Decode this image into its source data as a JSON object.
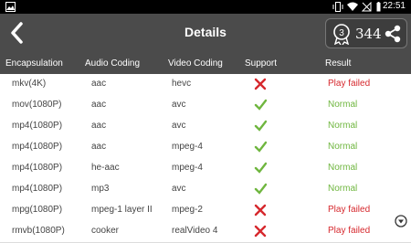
{
  "status": {
    "time": "22:51"
  },
  "header": {
    "title": "Details",
    "score": "344"
  },
  "table": {
    "columns": [
      "Encapsulation",
      "Audio Coding",
      "Video Coding",
      "Support",
      "Result"
    ],
    "rows": [
      {
        "encap": "mkv(4K)",
        "audio": "aac",
        "video": "hevc",
        "support": "cross",
        "result": "Play failed"
      },
      {
        "encap": "mov(1080P)",
        "audio": "aac",
        "video": "avc",
        "support": "check",
        "result": "Normal"
      },
      {
        "encap": "mp4(1080P)",
        "audio": "aac",
        "video": "avc",
        "support": "check",
        "result": "Normal"
      },
      {
        "encap": "mp4(1080P)",
        "audio": "aac",
        "video": "mpeg-4",
        "support": "check",
        "result": "Normal"
      },
      {
        "encap": "mp4(1080P)",
        "audio": "he-aac",
        "video": "mpeg-4",
        "support": "check",
        "result": "Normal"
      },
      {
        "encap": "mp4(1080P)",
        "audio": "mp3",
        "video": "avc",
        "support": "check",
        "result": "Normal"
      },
      {
        "encap": "mpg(1080P)",
        "audio": "mpeg-1 layer II",
        "video": "mpeg-2",
        "support": "cross",
        "result": "Play failed"
      },
      {
        "encap": "rmvb(1080P)",
        "audio": "cooker",
        "video": "realVideo 4",
        "support": "cross",
        "result": "Play failed"
      }
    ]
  },
  "colors": {
    "fail": "#d6282d",
    "ok": "#6fb63f",
    "bar": "#4b4b4b"
  }
}
